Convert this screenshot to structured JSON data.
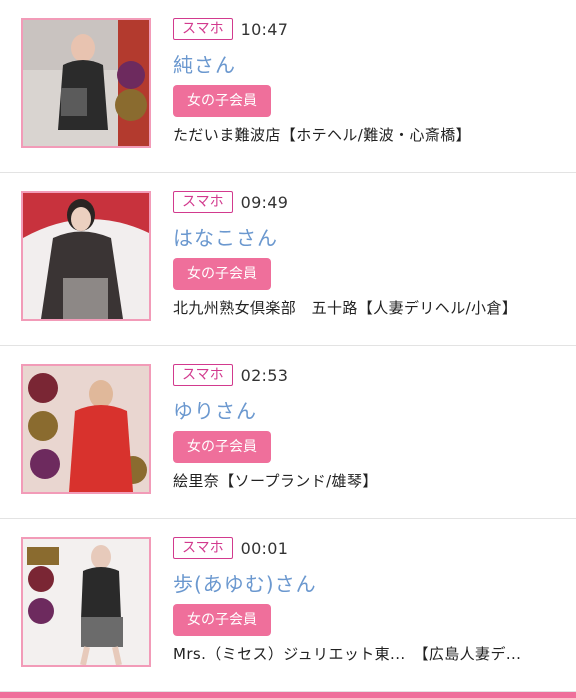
{
  "colors": {
    "accent_pink": "#ef6f9b",
    "badge_magenta": "#d23a8e",
    "name_blue": "#6b98cf",
    "divider": "#e3e3e3"
  },
  "items": [
    {
      "device": "スマホ",
      "time": "10:47",
      "name": "純さん",
      "member": "女の子会員",
      "shop": "ただいま難波店【ホテヘル/難波・心斎橋】",
      "thumb_icon": "profile-photo"
    },
    {
      "device": "スマホ",
      "time": "09:49",
      "name": "はなこさん",
      "member": "女の子会員",
      "shop": "北九州熟女倶楽部　五十路【人妻デリヘル/小倉】",
      "thumb_icon": "profile-photo"
    },
    {
      "device": "スマホ",
      "time": "02:53",
      "name": "ゆりさん",
      "member": "女の子会員",
      "shop": "絵里奈【ソープランド/雄琴】",
      "thumb_icon": "profile-photo"
    },
    {
      "device": "スマホ",
      "time": "00:01",
      "name": "歩(あゆむ)さん",
      "member": "女の子会員",
      "shop": "Mrs.（ミセス）ジュリエット東...　【広島人妻デ...",
      "thumb_icon": "profile-photo"
    }
  ]
}
